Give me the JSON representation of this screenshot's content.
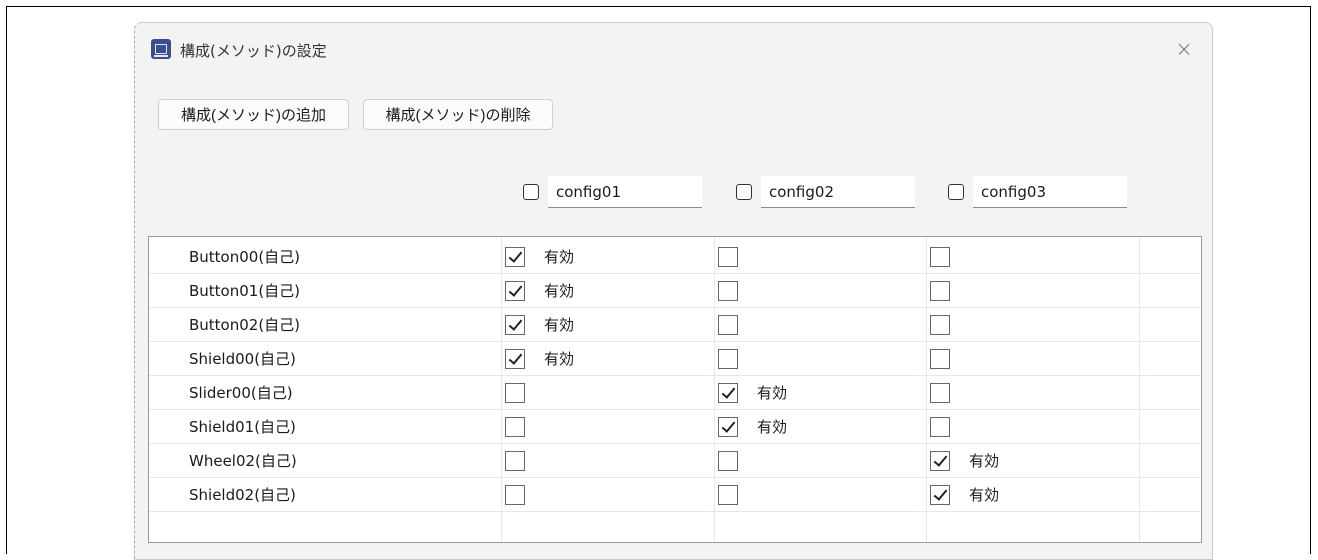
{
  "window": {
    "title": "構成(メソッド)の設定",
    "close_symbol": "×",
    "icon": "app-chip-icon"
  },
  "toolbar": {
    "add_label": "構成(メソッド)の追加",
    "delete_label": "構成(メソッド)の削除"
  },
  "configs": [
    {
      "name": "config01",
      "checked": false
    },
    {
      "name": "config02",
      "checked": false
    },
    {
      "name": "config03",
      "checked": false
    }
  ],
  "enabled_label": "有効",
  "rows": [
    {
      "name": "Button00(自己)",
      "enabled": [
        true,
        false,
        false
      ]
    },
    {
      "name": "Button01(自己)",
      "enabled": [
        true,
        false,
        false
      ]
    },
    {
      "name": "Button02(自己)",
      "enabled": [
        true,
        false,
        false
      ]
    },
    {
      "name": "Shield00(自己)",
      "enabled": [
        true,
        false,
        false
      ]
    },
    {
      "name": "Slider00(自己)",
      "enabled": [
        false,
        true,
        false
      ]
    },
    {
      "name": "Shield01(自己)",
      "enabled": [
        false,
        true,
        false
      ]
    },
    {
      "name": "Wheel02(自己)",
      "enabled": [
        false,
        false,
        true
      ]
    },
    {
      "name": "Shield02(自己)",
      "enabled": [
        false,
        false,
        true
      ]
    }
  ]
}
